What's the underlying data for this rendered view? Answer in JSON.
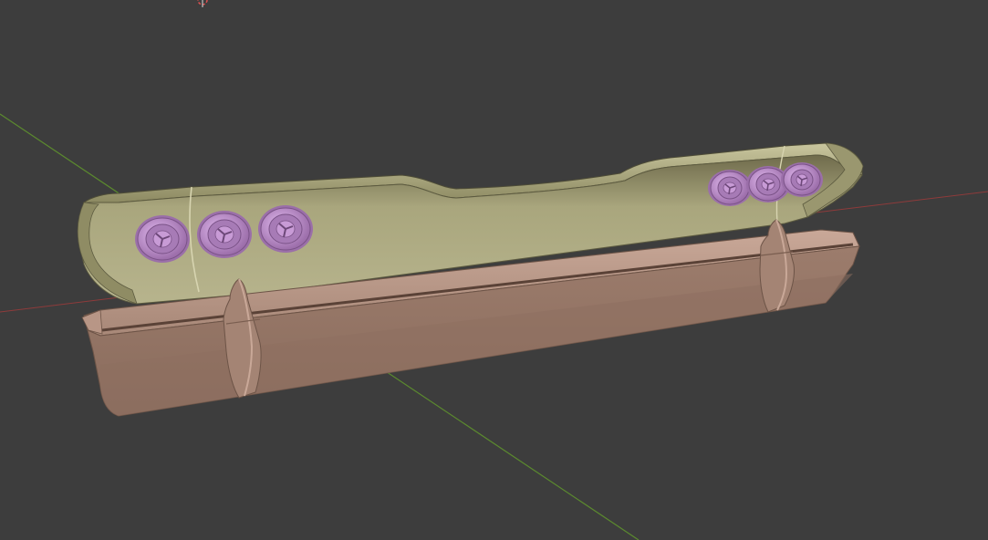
{
  "viewport": {
    "background_color": "#3d3d3d",
    "x_axis_color": "#9b3a3a",
    "y_axis_color": "#5b8a2e",
    "origin_marker": "3d-cursor-icon"
  },
  "objects": [
    {
      "name": "tail-panel",
      "material_color": "#a9a67d",
      "lamps": [
        {
          "side": "left",
          "count": 3,
          "color": "#b98cc6"
        },
        {
          "side": "right",
          "count": 3,
          "color": "#b98cc6"
        }
      ]
    },
    {
      "name": "rear-bumper",
      "material_color": "#a88878",
      "guards": 2
    }
  ]
}
